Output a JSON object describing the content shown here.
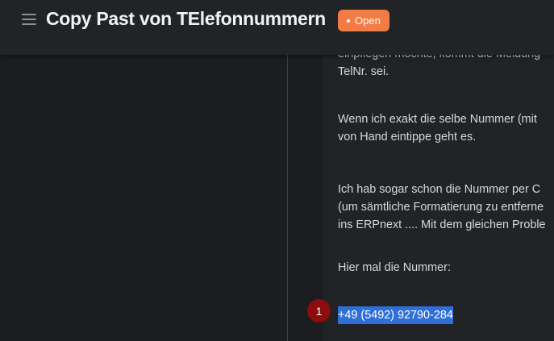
{
  "header": {
    "title": "Copy Past von TElefonnummern",
    "status": "Open"
  },
  "content": {
    "paragraphs": [
      [
        "einpflegen möchte, kommt die Meldung",
        "TelNr. sei."
      ],
      [
        "Wenn ich exakt die selbe Nummer (mit",
        "von Hand eintippe geht es."
      ],
      [
        "Ich hab sogar schon die Nummer per C",
        "(um sämtliche Formatierung zu entferne",
        "ins ERPnext .... Mit dem gleichen Proble"
      ],
      [
        "Hier mal die Nummer:"
      ]
    ],
    "phone_number": "+49 (5492) 92790-284"
  },
  "marker": {
    "label": "1",
    "color": "#8b0d0d"
  },
  "colors": {
    "accent_badge": "#f27c45",
    "selection": "#2f6fd8",
    "background": "#1c1e21"
  }
}
